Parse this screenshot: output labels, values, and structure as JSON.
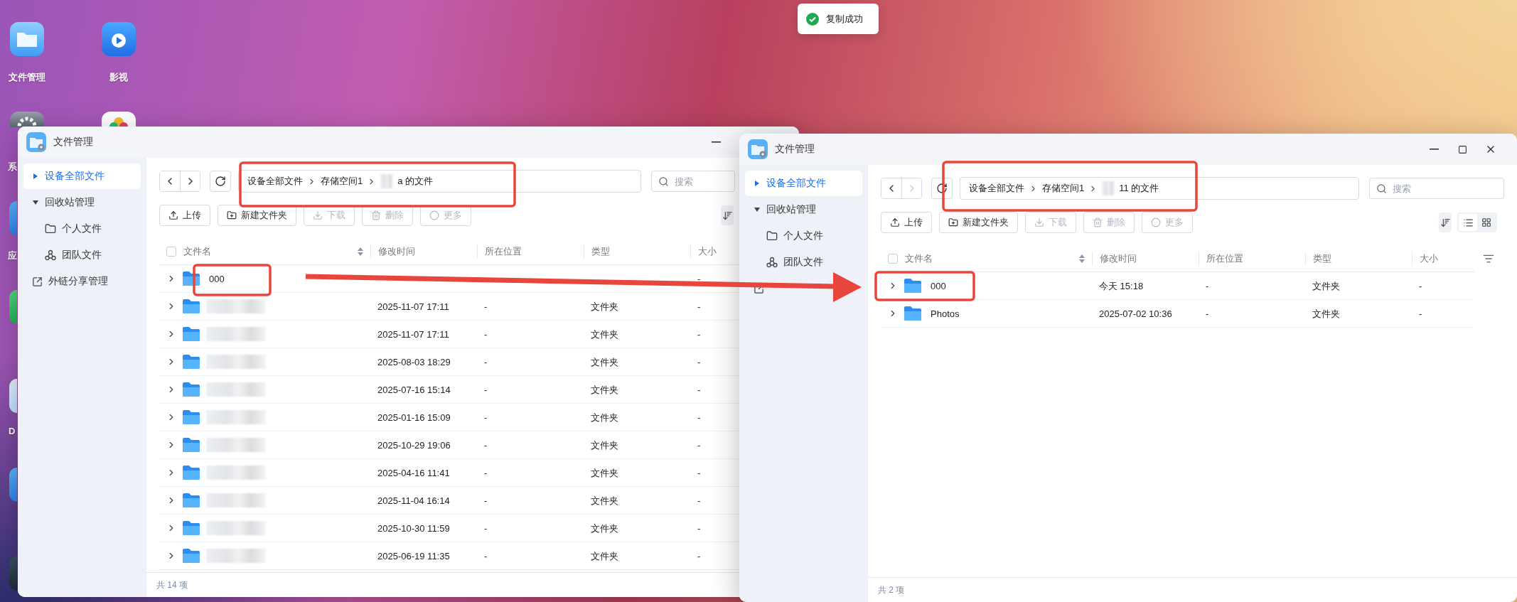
{
  "desktop": {
    "icons": [
      {
        "kind": "folder",
        "label": "文件管理"
      },
      {
        "kind": "video",
        "label": "影视"
      },
      {
        "kind": "gear",
        "label": "系"
      },
      {
        "kind": "photos"
      },
      {
        "kind": "blue",
        "label": "应"
      },
      {
        "kind": "green"
      },
      {
        "kind": "d",
        "label": "D"
      },
      {
        "kind": "blue"
      },
      {
        "kind": "dark"
      }
    ]
  },
  "toast": {
    "text": "复制成功"
  },
  "windows": [
    {
      "title": "文件管理",
      "controls": [
        {
          "kind": "minimize"
        }
      ],
      "sidebar": [
        {
          "label": "设备全部文件",
          "selected": true,
          "expanded": false
        },
        {
          "label": "回收站管理",
          "selected": false,
          "expanded": true,
          "children": [
            {
              "label": "个人文件",
              "selected": false
            },
            {
              "label": "团队文件",
              "selected": false
            }
          ]
        },
        {
          "label": "外链分享管理",
          "selected": false
        }
      ],
      "nav": [
        {
          "kind": "back",
          "disabled": false
        },
        {
          "kind": "forward",
          "disabled": false
        }
      ],
      "breadcrumb": [
        {
          "text": "设备全部文件",
          "blurred": false
        },
        {
          "text": "存储空间1",
          "blurred": false
        },
        {
          "text": "a 的文件",
          "blurred": true
        }
      ],
      "search": {
        "placeholder": "搜索"
      },
      "toolbar": [
        {
          "label": "上传",
          "disabled": false
        },
        {
          "label": "新建文件夹",
          "disabled": false
        },
        {
          "label": "下载",
          "disabled": true
        },
        {
          "label": "删除",
          "disabled": true
        },
        {
          "label": "更多",
          "disabled": true
        }
      ],
      "view_tools": [
        {
          "kind": "sort"
        }
      ],
      "table": {
        "select_all": {
          "checked": false
        },
        "columns": [
          "文件名",
          "修改时间",
          "所在位置",
          "类型",
          "大小"
        ],
        "rows": [
          {
            "name": "000",
            "name_blurred": false,
            "size": "-"
          },
          {
            "name_blurred": true,
            "modified": "2025-11-07 17:11",
            "location": "-",
            "type": "文件夹",
            "size": "-"
          },
          {
            "name_blurred": true,
            "modified": "2025-11-07 17:11",
            "location": "-",
            "type": "文件夹",
            "size": "-"
          },
          {
            "name_blurred": true,
            "modified": "2025-08-03 18:29",
            "location": "-",
            "type": "文件夹",
            "size": "-"
          },
          {
            "name_blurred": true,
            "modified": "2025-07-16 15:14",
            "location": "-",
            "type": "文件夹",
            "size": "-"
          },
          {
            "name_blurred": true,
            "modified": "2025-01-16 15:09",
            "location": "-",
            "type": "文件夹",
            "size": "-"
          },
          {
            "name_blurred": true,
            "modified": "2025-10-29 19:06",
            "location": "-",
            "type": "文件夹",
            "size": "-"
          },
          {
            "name_blurred": true,
            "modified": "2025-04-16 11:41",
            "location": "-",
            "type": "文件夹",
            "size": "-"
          },
          {
            "name_blurred": true,
            "modified": "2025-11-04 16:14",
            "location": "-",
            "type": "文件夹",
            "size": "-"
          },
          {
            "name_blurred": true,
            "modified": "2025-10-30 11:59",
            "location": "-",
            "type": "文件夹",
            "size": "-"
          },
          {
            "name_blurred": true,
            "modified": "2025-06-19 11:35",
            "location": "-",
            "type": "文件夹",
            "size": "-"
          }
        ]
      },
      "status": "共 14 项"
    },
    {
      "title": "文件管理",
      "controls": [
        {
          "kind": "minimize"
        },
        {
          "kind": "maximize"
        },
        {
          "kind": "close"
        }
      ],
      "sidebar": [
        {
          "label": "设备全部文件",
          "selected": true,
          "expanded": false
        },
        {
          "label": "回收站管理",
          "selected": false,
          "expanded": true,
          "children": [
            {
              "label": "个人文件",
              "selected": false
            },
            {
              "label": "团队文件",
              "selected": false
            }
          ]
        },
        {
          "selected": false
        }
      ],
      "nav": [
        {
          "kind": "back",
          "disabled": false
        },
        {
          "kind": "forward",
          "disabled": true
        }
      ],
      "breadcrumb": [
        {
          "text": "设备全部文件",
          "blurred": false
        },
        {
          "text": "存储空间1",
          "blurred": false
        },
        {
          "text": "11 的文件",
          "blurred": true
        }
      ],
      "search": {
        "placeholder": "搜索"
      },
      "toolbar": [
        {
          "label": "上传",
          "disabled": false
        },
        {
          "label": "新建文件夹",
          "disabled": false
        },
        {
          "label": "下载",
          "disabled": true
        },
        {
          "label": "删除",
          "disabled": true
        },
        {
          "label": "更多",
          "disabled": true
        }
      ],
      "view_tools": [
        {
          "kind": "sort"
        },
        {
          "kind": "list",
          "selected": true
        },
        {
          "kind": "grid",
          "selected": false
        }
      ],
      "table": {
        "select_all": {
          "checked": false
        },
        "columns": [
          "文件名",
          "修改时间",
          "所在位置",
          "类型",
          "大小"
        ],
        "tools": [
          {
            "kind": "filter"
          }
        ],
        "rows": [
          {
            "name": "000",
            "name_blurred": false,
            "modified": "今天 15:18",
            "location": "-",
            "type": "文件夹",
            "size": "-"
          },
          {
            "name": "Photos",
            "name_blurred": false,
            "modified": "2025-07-02 10:36",
            "location": "-",
            "type": "文件夹",
            "size": "-"
          }
        ]
      },
      "status": "共 2 项"
    }
  ]
}
